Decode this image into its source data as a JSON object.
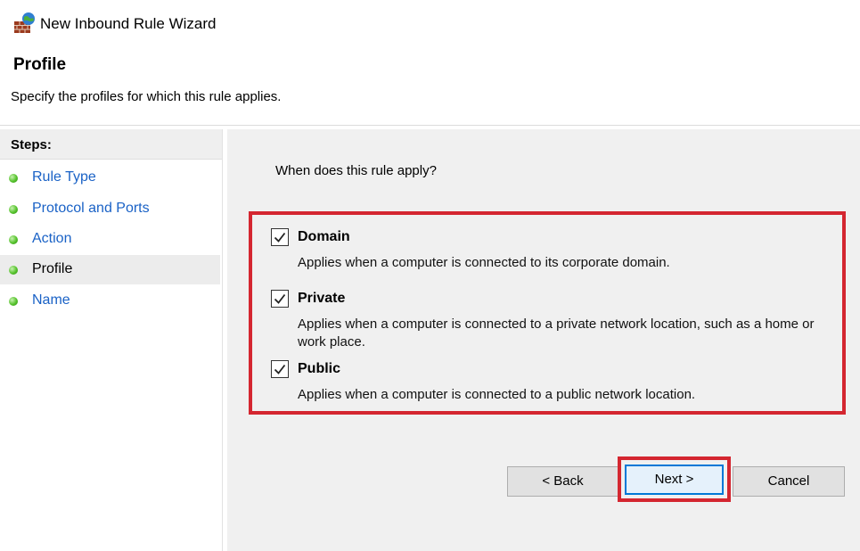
{
  "window": {
    "title": "New Inbound Rule Wizard",
    "icon": "firewall-wall-globe-icon"
  },
  "header": {
    "title": "Profile",
    "subtitle": "Specify the profiles for which this rule applies."
  },
  "steps": {
    "heading": "Steps:",
    "items": [
      {
        "label": "Rule Type",
        "active": false
      },
      {
        "label": "Protocol and Ports",
        "active": false
      },
      {
        "label": "Action",
        "active": false
      },
      {
        "label": "Profile",
        "active": true
      },
      {
        "label": "Name",
        "active": false
      }
    ]
  },
  "content": {
    "question": "When does this rule apply?",
    "options": [
      {
        "label": "Domain",
        "checked": true,
        "description": "Applies when a computer is connected to its corporate domain."
      },
      {
        "label": "Private",
        "checked": true,
        "description": "Applies when a computer is connected to a private network location, such as a home or work place."
      },
      {
        "label": "Public",
        "checked": true,
        "description": "Applies when a computer is connected to a public network location."
      }
    ]
  },
  "buttons": {
    "back": "< Back",
    "next": "Next >",
    "cancel": "Cancel"
  },
  "colors": {
    "highlight": "#d42630",
    "link": "#1a62c6",
    "focus": "#0078d7",
    "panel": "#f0f0f0"
  }
}
